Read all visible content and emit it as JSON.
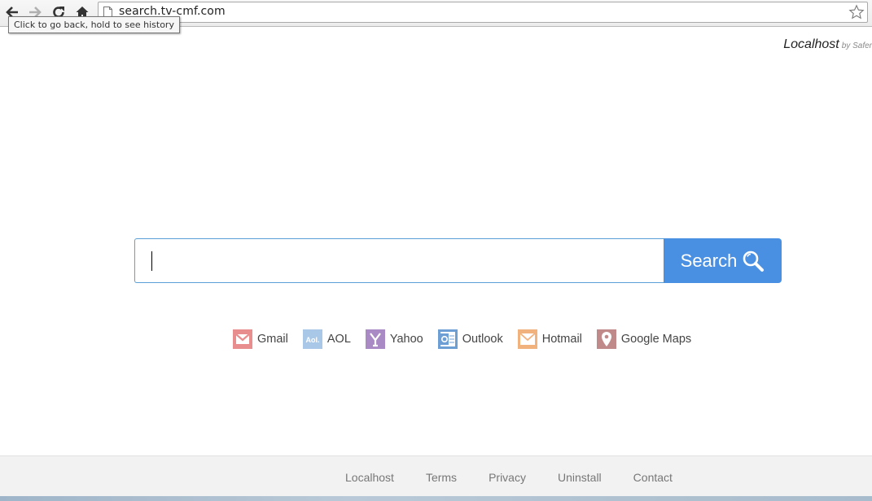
{
  "browser": {
    "url": "search.tv-cmf.com",
    "back_tooltip": "Click to go back, hold to see history"
  },
  "brand": {
    "name": "Localhost",
    "by": "by Safer"
  },
  "search": {
    "input_value": "",
    "button_label": "Search"
  },
  "quick_links": [
    {
      "label": "Gmail",
      "icon": "gmail-icon",
      "color": "#e88e8e"
    },
    {
      "label": "AOL",
      "icon": "aol-icon",
      "color": "#a9c8e8"
    },
    {
      "label": "Yahoo",
      "icon": "yahoo-icon",
      "color": "#a98ac4"
    },
    {
      "label": "Outlook",
      "icon": "outlook-icon",
      "color": "#6e9fd4"
    },
    {
      "label": "Hotmail",
      "icon": "hotmail-icon",
      "color": "#f2b27e"
    },
    {
      "label": "Google Maps",
      "icon": "google-maps-icon",
      "color": "#c08a8a"
    }
  ],
  "footer": {
    "links": [
      "Localhost",
      "Terms",
      "Privacy",
      "Uninstall",
      "Contact"
    ]
  },
  "colors": {
    "search_button": "#4a90e2",
    "search_border": "#5a9fd8",
    "footer_bg": "#f2f2f2"
  }
}
